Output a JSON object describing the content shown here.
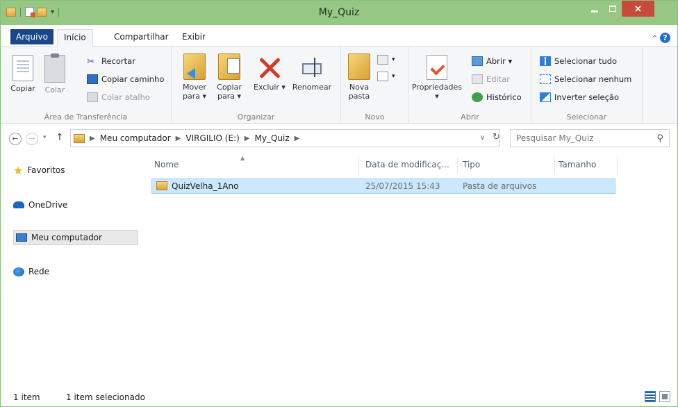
{
  "window": {
    "title": "My_Quiz"
  },
  "window_controls": {
    "minimize": "minimize",
    "maximize": "maximize",
    "close": "×"
  },
  "tabs": [
    {
      "label": "Arquivo"
    },
    {
      "label": "Início"
    },
    {
      "label": "Compartilhar"
    },
    {
      "label": "Exibir"
    }
  ],
  "ribbon": {
    "groups": {
      "clipboard": "Área de Transferência",
      "organize": "Organizar",
      "new": "Novo",
      "open": "Abrir",
      "select": "Selecionar"
    },
    "copy": "Copiar",
    "paste": "Colar",
    "cut": "Recortar",
    "copy_path": "Copiar caminho",
    "paste_shortcut": "Colar atalho",
    "move_to": "Mover para ▾",
    "copy_to": "Copiar para ▾",
    "delete": "Excluir ▾",
    "rename": "Renomear",
    "new_folder": "Nova pasta",
    "properties": "Propriedades ▾",
    "open_btn": "Abrir ▾",
    "edit": "Editar",
    "history": "Histórico",
    "select_all": "Selecionar tudo",
    "select_none": "Selecionar nenhum",
    "invert_selection": "Inverter seleção"
  },
  "address": {
    "breadcrumbs": [
      "Meu computador",
      "VIRGILIO (E:)",
      "My_Quiz"
    ],
    "search_placeholder": "Pesquisar My_Quiz"
  },
  "nav_pane": {
    "items": [
      {
        "label": "Favoritos",
        "icon": "star-icon"
      },
      {
        "label": "OneDrive",
        "icon": "onedrive-icon"
      },
      {
        "label": "Meu computador",
        "icon": "computer-icon",
        "selected": true
      },
      {
        "label": "Rede",
        "icon": "network-icon"
      }
    ]
  },
  "file_list": {
    "columns": [
      "Nome",
      "Data de modificaç...",
      "Tipo",
      "Tamanho"
    ],
    "rows": [
      {
        "name": "QuizVelha_1Ano",
        "modified": "25/07/2015 15:43",
        "type": "Pasta de arquivos",
        "size": "",
        "selected": true
      }
    ]
  },
  "status_bar": {
    "count": "1 item",
    "selection": "1 item selecionado"
  },
  "colors": {
    "titlebar": "#97c784",
    "file_tab": "#19478a",
    "selection": "#cce8ff",
    "close_button": "#c74b3c"
  }
}
